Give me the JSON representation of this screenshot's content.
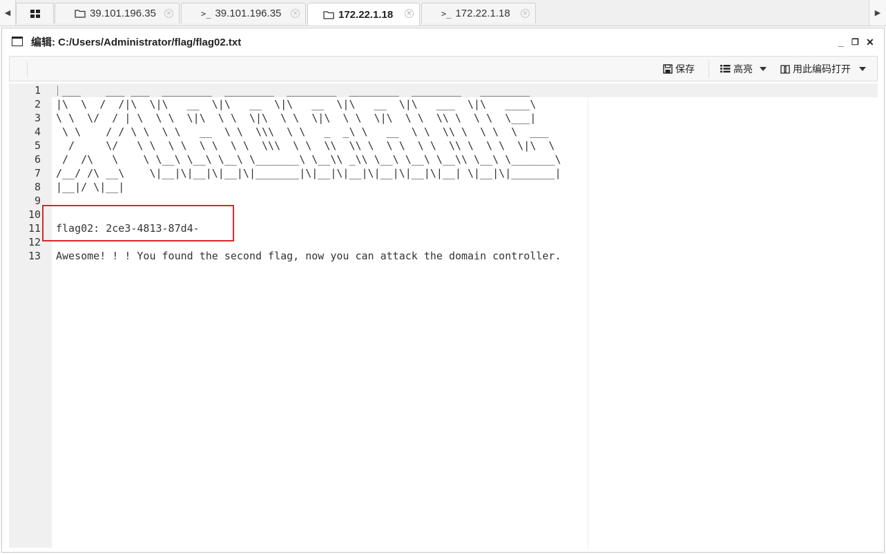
{
  "tabs": [
    {
      "icon": "folder-icon",
      "label": "39.101.196.35",
      "active": false
    },
    {
      "icon": "terminal-icon",
      "label": "39.101.196.35",
      "active": false
    },
    {
      "icon": "folder-icon",
      "label": "172.22.1.18",
      "active": true
    },
    {
      "icon": "terminal-icon",
      "label": "172.22.1.18",
      "active": false
    }
  ],
  "window": {
    "title": "编辑: C:/Users/Administrator/flag/flag02.txt",
    "minimize": "_",
    "restore": "❐",
    "close": "✕"
  },
  "toolbar": {
    "save_label": "保存",
    "highlight_label": "高亮",
    "open_with_encoding_label": "用此编码打开"
  },
  "editor": {
    "lines": [
      {
        "num": "1",
        "text": " ___    ___ ___  ________  ________  ________  ________  ________   ________"
      },
      {
        "num": "2",
        "text": "|\\  \\  /  /|\\  \\|\\   __  \\|\\   __  \\|\\   __  \\|\\   __  \\|\\   ___  \\|\\   ____\\"
      },
      {
        "num": "3",
        "text": "\\ \\  \\/  / | \\  \\ \\  \\|\\  \\ \\  \\|\\  \\ \\  \\|\\  \\ \\  \\|\\  \\ \\  \\\\ \\  \\ \\  \\___|"
      },
      {
        "num": "4",
        "text": " \\ \\    / / \\ \\  \\ \\   __  \\ \\  \\\\\\  \\ \\   _  _\\ \\   __  \\ \\  \\\\ \\  \\ \\  \\  ___"
      },
      {
        "num": "5",
        "text": "  /     \\/   \\ \\  \\ \\  \\ \\  \\ \\  \\\\\\  \\ \\  \\\\  \\\\ \\  \\ \\  \\ \\  \\\\ \\  \\ \\  \\|\\  \\"
      },
      {
        "num": "6",
        "text": " /  /\\   \\    \\ \\__\\ \\__\\ \\__\\ \\_______\\ \\__\\\\ _\\\\ \\__\\ \\__\\ \\__\\\\ \\__\\ \\_______\\"
      },
      {
        "num": "7",
        "text": "/__/ /\\ __\\    \\|__|\\|__|\\|__|\\|_______|\\|__|\\|__|\\|__|\\|__|\\|__| \\|__|\\|_______|"
      },
      {
        "num": "8",
        "text": "|__|/ \\|__|"
      },
      {
        "num": "9",
        "text": ""
      },
      {
        "num": "10",
        "text": ""
      },
      {
        "num": "11",
        "text": "flag02: 2ce3-4813-87d4-"
      },
      {
        "num": "12",
        "text": ""
      },
      {
        "num": "13",
        "text": "Awesome! ! ! You found the second flag, now you can attack the domain controller."
      }
    ]
  }
}
